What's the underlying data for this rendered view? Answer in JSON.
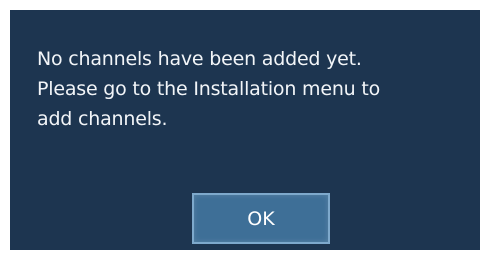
{
  "dialog": {
    "message_lines": [
      "No channels have been added yet.",
      "Please go to the Installation menu to",
      "add channels."
    ],
    "ok_label": "OK"
  },
  "colors": {
    "background": "#1d3550",
    "button": "#3e6f97",
    "button_border": "#7ea9cc",
    "text": "#f2f5f8"
  }
}
